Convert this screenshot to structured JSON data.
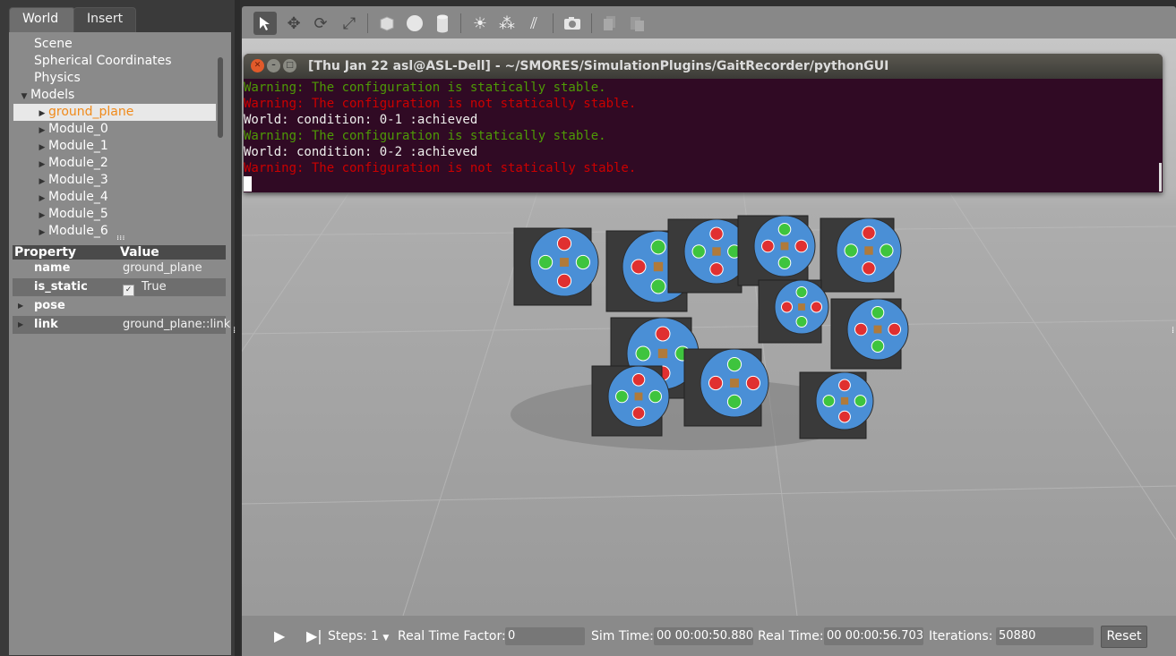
{
  "left_panel": {
    "tabs": [
      "World",
      "Insert"
    ],
    "tree": {
      "items": [
        {
          "label": "Scene",
          "expandable": false
        },
        {
          "label": "Spherical Coordinates",
          "expandable": false
        },
        {
          "label": "Physics",
          "expandable": false
        },
        {
          "label": "Models",
          "expanded": true
        },
        {
          "label": "ground_plane",
          "selected": true
        },
        {
          "label": "Module_0"
        },
        {
          "label": "Module_1"
        },
        {
          "label": "Module_2"
        },
        {
          "label": "Module_3"
        },
        {
          "label": "Module_4"
        },
        {
          "label": "Module_5"
        },
        {
          "label": "Module_6"
        }
      ]
    },
    "properties": {
      "header": {
        "property": "Property",
        "value": "Value"
      },
      "rows": [
        {
          "key": "name",
          "value": "ground_plane"
        },
        {
          "key": "is_static",
          "value": "True",
          "checked": true
        },
        {
          "key": "pose",
          "value": ""
        },
        {
          "key": "link",
          "value": "ground_plane::link"
        }
      ]
    }
  },
  "toolbar": {
    "tools": [
      "select-arrow-icon",
      "translate-icon",
      "rotate-icon",
      "scale-icon",
      "box-icon",
      "sphere-icon",
      "cylinder-icon",
      "point-light-icon",
      "spot-light-icon",
      "directional-light-icon",
      "screenshot-icon",
      "copy-icon",
      "paste-icon"
    ]
  },
  "terminal": {
    "title": "[Thu Jan 22 asl@ASL-Dell] - ~/SMORES/SimulationPlugins/GaitRecorder/pythonGUI",
    "lines": [
      {
        "text": "Warning: The configuration is statically stable.",
        "color": "green"
      },
      {
        "text": "Warning: The configuration is not statically stable.",
        "color": "red"
      },
      {
        "text": "World: condition: 0-1 :achieved",
        "color": "white"
      },
      {
        "text": "Warning: The configuration is statically stable.",
        "color": "green"
      },
      {
        "text": "World: condition: 0-2 :achieved",
        "color": "white"
      },
      {
        "text": "Warning: The configuration is not statically stable.",
        "color": "red"
      }
    ]
  },
  "bottom_bar": {
    "steps_label": "Steps:",
    "steps_value": "1",
    "real_time_factor_label": "Real Time Factor:",
    "real_time_factor": "0",
    "sim_time_label": "Sim Time:",
    "sim_time": "00 00:00:50.880",
    "real_time_label": "Real Time:",
    "real_time": "00 00:00:56.703",
    "iterations_label": "Iterations:",
    "iterations": "50880",
    "reset_label": "Reset"
  },
  "colors": {
    "terminal_bg": "#300a24",
    "selected_item": "#f08a1a",
    "module_face": "#4a8fd6",
    "connector_green": "#3ec43e",
    "connector_red": "#e03030"
  }
}
